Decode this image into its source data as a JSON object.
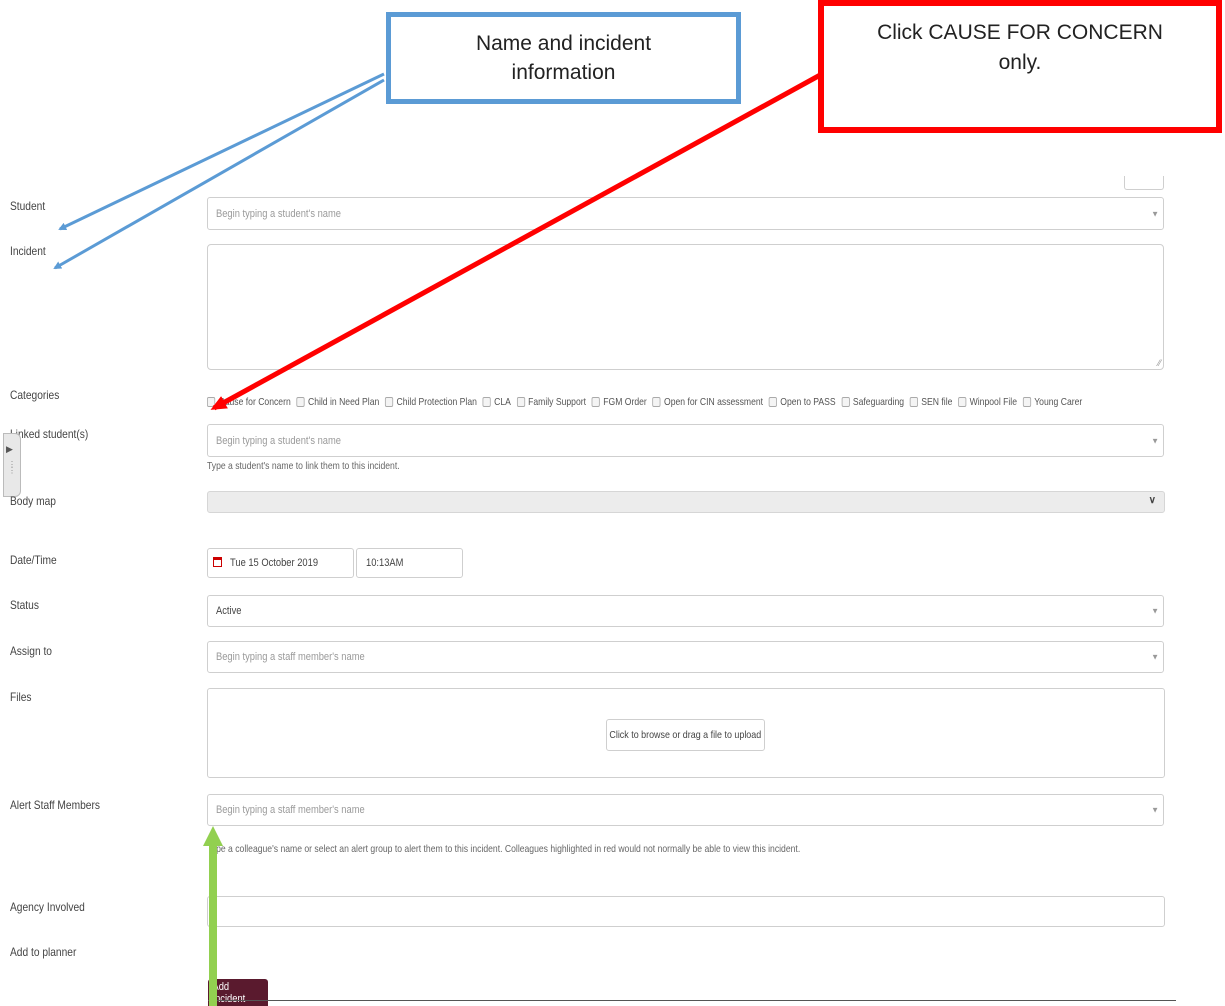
{
  "callouts": {
    "blue_text": "Name and incident information",
    "red_text": "Click CAUSE FOR CONCERN only."
  },
  "colors": {
    "blue_callout": "#5b9bd5",
    "red_callout": "#ff0000",
    "green_arrow": "#92d050",
    "add_button": "#5a1a2e"
  },
  "form": {
    "student": {
      "label": "Student",
      "placeholder": "Begin typing a student's name"
    },
    "incident": {
      "label": "Incident"
    },
    "categories": {
      "label": "Categories",
      "items": [
        "Cause for Concern",
        "Child in Need Plan",
        "Child Protection Plan",
        "CLA",
        "Family Support",
        "FGM Order",
        "Open for CIN assessment",
        "Open to PASS",
        "Safeguarding",
        "SEN file",
        "Winpool File",
        "Young Carer"
      ]
    },
    "linked": {
      "label": "Linked student(s)",
      "placeholder": "Begin typing a student's name",
      "help": "Type a student's name to link them to this incident."
    },
    "body_map": {
      "label": "Body map"
    },
    "datetime": {
      "label": "Date/Time",
      "date": "Tue 15 October 2019",
      "time": "10:13AM"
    },
    "status": {
      "label": "Status",
      "value": "Active"
    },
    "assign": {
      "label": "Assign to",
      "placeholder": "Begin typing a staff member's name"
    },
    "files": {
      "label": "Files",
      "upload": "Click to browse or drag a file to upload"
    },
    "alert": {
      "label": "Alert Staff Members",
      "placeholder": "Begin typing a staff member's name",
      "help": "Type a colleague's name or select an alert group to alert them to this incident. Colleagues highlighted in red would not normally be able to view this incident."
    },
    "agency": {
      "label": "Agency Involved"
    },
    "planner": {
      "label": "Add to planner"
    },
    "submit": "Add Incident"
  }
}
